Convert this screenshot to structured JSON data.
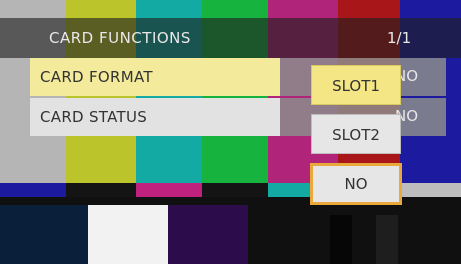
{
  "window": {
    "title": "CARD FUNCTIONS",
    "page_indicator": "1/1"
  },
  "menu": {
    "items": [
      {
        "label": "CARD FORMAT",
        "value": "NO",
        "selected": true
      },
      {
        "label": "CARD STATUS",
        "value": "NO",
        "selected": false
      }
    ]
  },
  "submenu": {
    "options": [
      {
        "label": "SLOT1",
        "highlighted": true
      },
      {
        "label": "SLOT2",
        "highlighted": false
      },
      {
        "label": "NO",
        "focused": true
      }
    ]
  },
  "colors": {
    "selected_item": "#f3ea9b",
    "normal_item": "#e2e2e2",
    "focus_border": "#e8a93a",
    "slot1_bg": "#f4e685",
    "option_bg": "#e6e6e6"
  }
}
